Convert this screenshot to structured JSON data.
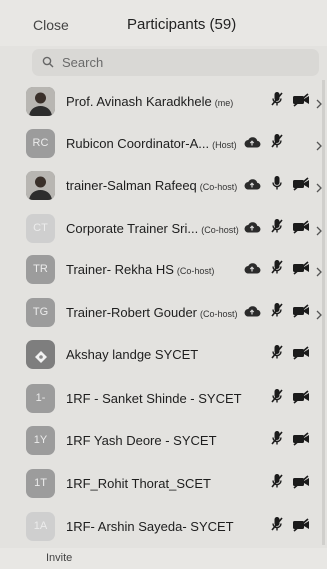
{
  "header": {
    "close_label": "Close",
    "title": "Participants (59)"
  },
  "search": {
    "placeholder": "Search"
  },
  "participants": [
    {
      "avatar": "photo",
      "name": "Prof. Avinash Karadkhele",
      "role": "(me)",
      "cloud": false,
      "mic": "muted",
      "video": "off",
      "more": true
    },
    {
      "avatar": "RC",
      "name": "Rubicon Coordinator-A...",
      "role": "(Host)",
      "cloud": true,
      "mic": "muted",
      "video": "",
      "more": true
    },
    {
      "avatar": "photo",
      "name": "trainer-Salman Rafeeq",
      "role": "(Co-host)",
      "cloud": true,
      "mic": "on",
      "video": "off",
      "more": true
    },
    {
      "avatar": "CT",
      "name": "Corporate Trainer Sri...",
      "role": "(Co-host)",
      "cloud": true,
      "mic": "muted",
      "video": "off",
      "more": true
    },
    {
      "avatar": "TR",
      "name": "Trainer- Rekha HS",
      "role": "(Co-host)",
      "cloud": true,
      "mic": "muted",
      "video": "off",
      "more": true
    },
    {
      "avatar": "TG",
      "name": "Trainer-Robert Gouder",
      "role": "(Co-host)",
      "cloud": true,
      "mic": "muted",
      "video": "off",
      "more": true
    },
    {
      "avatar": "icon",
      "name": "Akshay landge SYCET",
      "role": "",
      "cloud": false,
      "mic": "muted",
      "video": "off",
      "more": false
    },
    {
      "avatar": "1-",
      "name": "1RF - Sanket Shinde - SYCET",
      "role": "",
      "cloud": false,
      "mic": "muted",
      "video": "off",
      "more": false
    },
    {
      "avatar": "1Y",
      "name": "1RF Yash Deore - SYCET",
      "role": "",
      "cloud": false,
      "mic": "muted",
      "video": "off",
      "more": false
    },
    {
      "avatar": "1T",
      "name": "1RF_Rohit Thorat_SCET",
      "role": "",
      "cloud": false,
      "mic": "muted",
      "video": "off",
      "more": false
    },
    {
      "avatar": "1A",
      "name": "1RF- Arshin Sayeda- SYCET",
      "role": "",
      "cloud": false,
      "mic": "muted",
      "video": "off",
      "more": false
    }
  ],
  "footer": {
    "invite_label": "Invite"
  }
}
